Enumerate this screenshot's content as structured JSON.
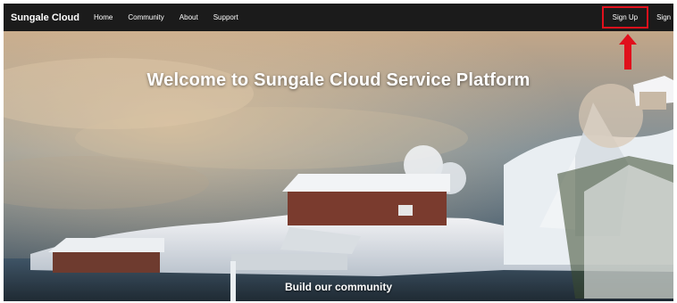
{
  "navbar": {
    "brand": "Sungale Cloud",
    "links": [
      "Home",
      "Community",
      "About",
      "Support"
    ],
    "signup_label": "Sign Up",
    "signin_label": "Sign In"
  },
  "hero": {
    "title": "Welcome to Sungale Cloud Service Platform",
    "subtitle": "Build our community"
  },
  "annotation": {
    "highlight_color": "#e0101c",
    "arrow_icon": "arrow-up-icon"
  }
}
